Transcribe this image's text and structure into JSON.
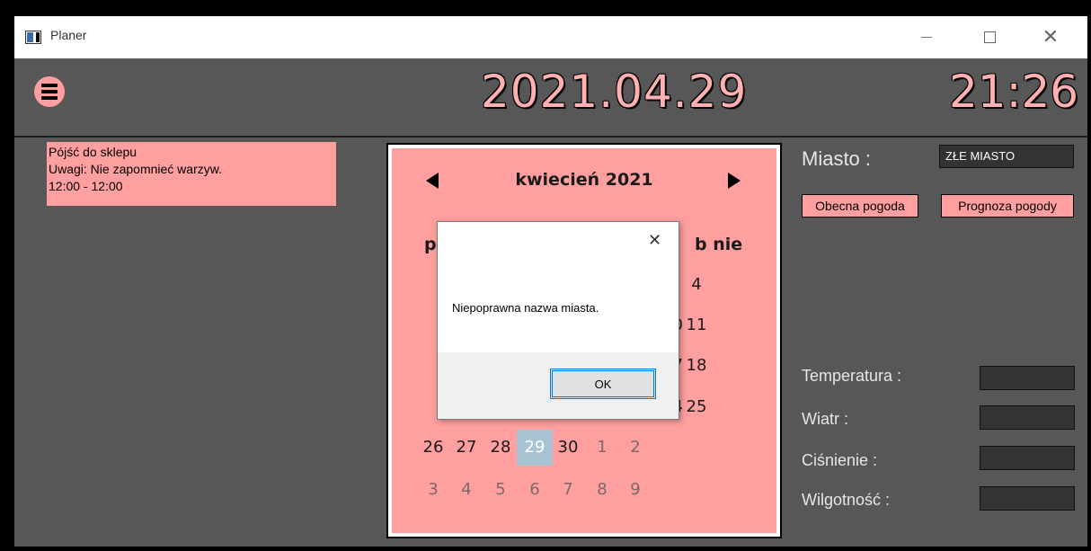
{
  "window": {
    "title": "Planer"
  },
  "header": {
    "date": "2021.04.29",
    "time": "21:26"
  },
  "task": {
    "title": "Pójść do sklepu",
    "note": "Uwagi: Nie zapomnieć warzyw.",
    "time": "12:00  - 12:00"
  },
  "calendar": {
    "month_label": "kwiecień 2021",
    "weekday_left": "p",
    "weekday_right": "b nie",
    "visible_days": [
      {
        "label": "4",
        "muted": false
      },
      {
        "label": "0",
        "muted": false
      },
      {
        "label": "11",
        "muted": false
      },
      {
        "label": "7",
        "muted": false
      },
      {
        "label": "18",
        "muted": false
      },
      {
        "label": "4",
        "muted": false
      },
      {
        "label": "25",
        "muted": false
      },
      {
        "label": "26",
        "muted": false
      },
      {
        "label": "27",
        "muted": false
      },
      {
        "label": "28",
        "muted": false
      },
      {
        "label": "29",
        "muted": false,
        "selected": true
      },
      {
        "label": "30",
        "muted": false
      },
      {
        "label": "1",
        "muted": true
      },
      {
        "label": "2",
        "muted": true
      },
      {
        "label": "3",
        "muted": true
      },
      {
        "label": "4",
        "muted": true
      },
      {
        "label": "5",
        "muted": true
      },
      {
        "label": "6",
        "muted": true
      },
      {
        "label": "7",
        "muted": true
      },
      {
        "label": "8",
        "muted": true
      },
      {
        "label": "9",
        "muted": true
      }
    ]
  },
  "dialog": {
    "message": "Niepoprawna nazwa miasta.",
    "ok_label": "OK",
    "close_glyph": "✕"
  },
  "weather": {
    "city_label": "Miasto :",
    "city_value": "ZŁE MIASTO",
    "current_button": "Obecna pogoda",
    "forecast_button": "Prognoza pogody",
    "temperature_label": "Temperatura :",
    "wind_label": "Wiatr :",
    "pressure_label": "Ciśnienie :",
    "humidity_label": "Wilgotność :"
  },
  "colors": {
    "accent_pink": "#ff9f9f",
    "background": "#575757",
    "selected_day": "#a8c4d4"
  }
}
